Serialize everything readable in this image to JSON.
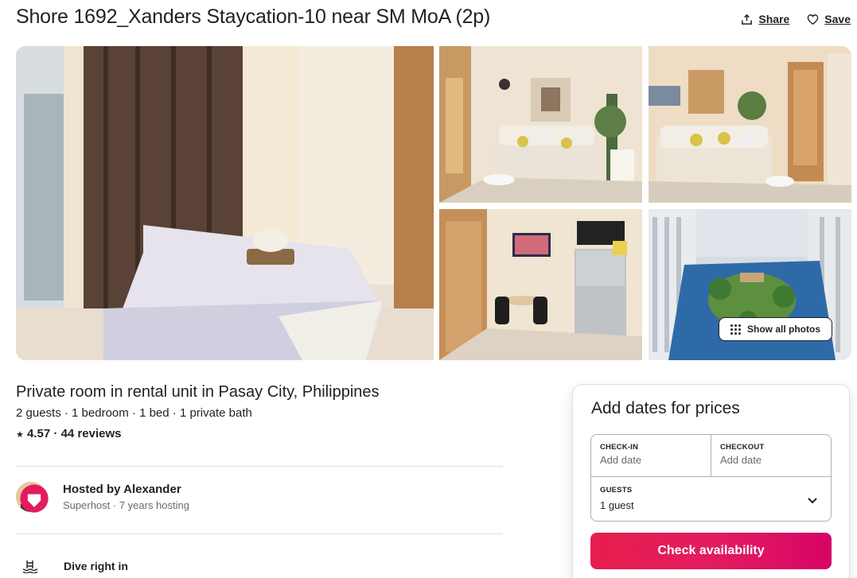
{
  "header": {
    "title": "Shore 1692_Xanders Staycation-10 near SM MoA (2p)",
    "share_label": "Share",
    "save_label": "Save"
  },
  "gallery": {
    "show_all_label": "Show all photos",
    "photos": [
      "bedroom",
      "living-room",
      "living-room-wide",
      "dining-kitchen",
      "pool-view"
    ]
  },
  "listing": {
    "type_title": "Private room in rental unit in Pasay City, Philippines",
    "facts": "2 guests · 1 bedroom · 1 bed · 1 private bath",
    "rating_star": "★",
    "rating": "4.57 · 44 reviews"
  },
  "host": {
    "name": "Hosted by Alexander",
    "subtitle": "Superhost · 7 years hosting"
  },
  "features": [
    {
      "title": "Dive right in",
      "icon": "pool-icon"
    }
  ],
  "booking": {
    "title": "Add dates for prices",
    "checkin_label": "CHECK-IN",
    "checkin_value": "Add date",
    "checkout_label": "CHECKOUT",
    "checkout_value": "Add date",
    "guests_label": "GUESTS",
    "guests_value": "1 guest",
    "cta_label": "Check availability"
  },
  "colors": {
    "accent": "#e31c5f",
    "text": "#222222",
    "muted": "#6a6a6a"
  }
}
